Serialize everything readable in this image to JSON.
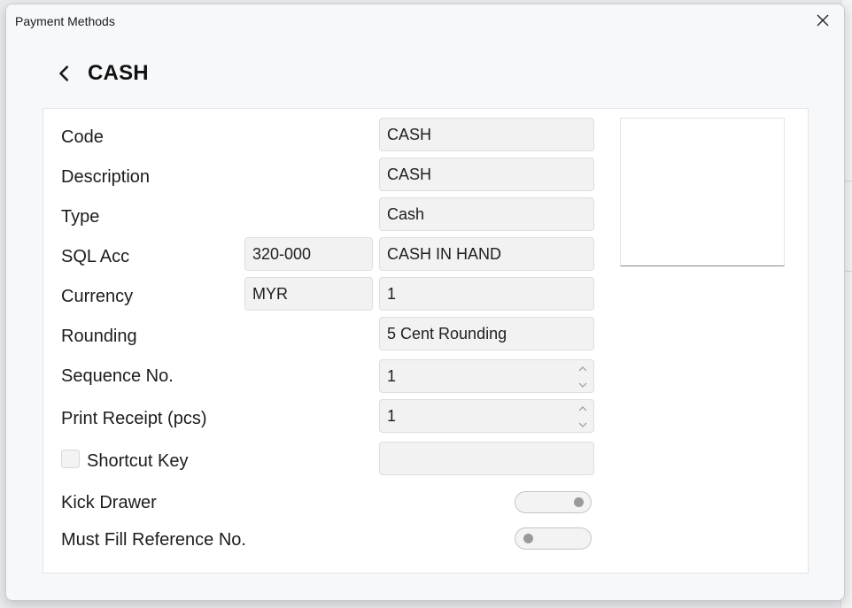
{
  "window": {
    "title": "Payment Methods"
  },
  "page": {
    "title": "CASH"
  },
  "form": {
    "code": {
      "label": "Code",
      "value": "CASH"
    },
    "description": {
      "label": "Description",
      "value": "CASH"
    },
    "type": {
      "label": "Type",
      "value": "Cash"
    },
    "sql_acc": {
      "label": "SQL Acc",
      "code": "320-000",
      "name": "CASH IN HAND"
    },
    "currency": {
      "label": "Currency",
      "code": "MYR",
      "rate": "1"
    },
    "rounding": {
      "label": "Rounding",
      "value": "5 Cent Rounding"
    },
    "sequence_no": {
      "label": "Sequence No.",
      "value": "1"
    },
    "print_receipt": {
      "label": "Print Receipt (pcs)",
      "value": "1"
    },
    "shortcut_key": {
      "label": "Shortcut Key",
      "checked": false,
      "value": ""
    },
    "kick_drawer": {
      "label": "Kick Drawer",
      "on": true
    },
    "must_fill_reference": {
      "label": "Must Fill Reference No.",
      "on": false
    }
  },
  "icons": {
    "close": "close-icon",
    "back": "chevron-left-icon",
    "spinner_up": "chevron-up-icon",
    "spinner_down": "chevron-down-icon"
  },
  "colors": {
    "field_bg": "#f2f2f2",
    "panel_bg": "#ffffff",
    "dialog_bg": "#f7f8fa",
    "toggle_knob": "#9a9a9a"
  }
}
